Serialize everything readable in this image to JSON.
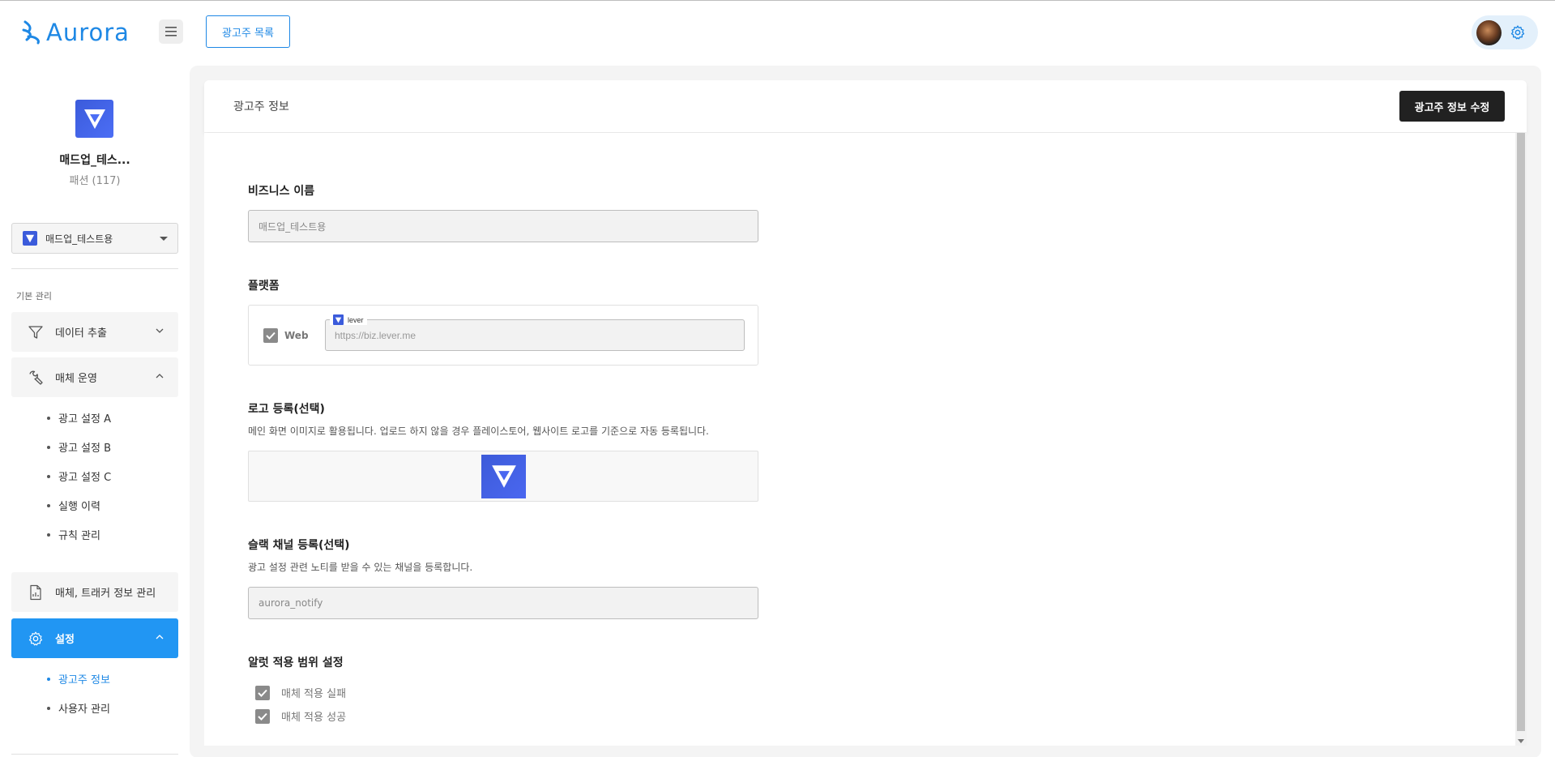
{
  "header": {
    "logo_text": "Aurora",
    "advertiser_list_button": "광고주 목록"
  },
  "sidebar": {
    "brand_name": "매드업_테스...",
    "brand_category": "패션 (117)",
    "account_select_value": "매드업_테스트용",
    "section_label": "기본 관리",
    "nav": {
      "data_extract": "데이터 추출",
      "media_ops": "매체 운영",
      "media_tracker": "매체, 트래커 정보 관리",
      "settings": "설정"
    },
    "media_ops_sub": [
      "광고 설정 A",
      "광고 설정 B",
      "광고 설정 C",
      "실행 이력",
      "규칙 관리"
    ],
    "settings_sub": [
      "광고주 정보",
      "사용자 관리"
    ]
  },
  "main": {
    "card_title": "광고주 정보",
    "edit_button": "광고주 정보 수정",
    "business_name": {
      "label": "비즈니스 이름",
      "value": "매드업_테스트용"
    },
    "platform": {
      "label": "플랫폼",
      "checkbox_label": "Web",
      "url_legend": "lever",
      "url_value": "https://biz.lever.me"
    },
    "logo": {
      "label": "로고 등록(선택)",
      "description": "메인 화면 이미지로 활용됩니다. 업로드 하지 않을 경우 플레이스토어, 웹사이트 로고를 기준으로 자동 등록됩니다."
    },
    "slack": {
      "label": "슬랙 채널 등록(선택)",
      "description": "광고 설정 관련 노티를 받을 수 있는 채널을 등록합니다.",
      "value": "aurora_notify"
    },
    "alert_scope": {
      "label": "알럿 적용 범위 설정",
      "options": [
        "매체 적용 실패",
        "매체 적용 성공"
      ]
    }
  },
  "colors": {
    "accent": "#2196f3",
    "brand_logo": "#3b5bdb",
    "dark_button": "#212121"
  }
}
